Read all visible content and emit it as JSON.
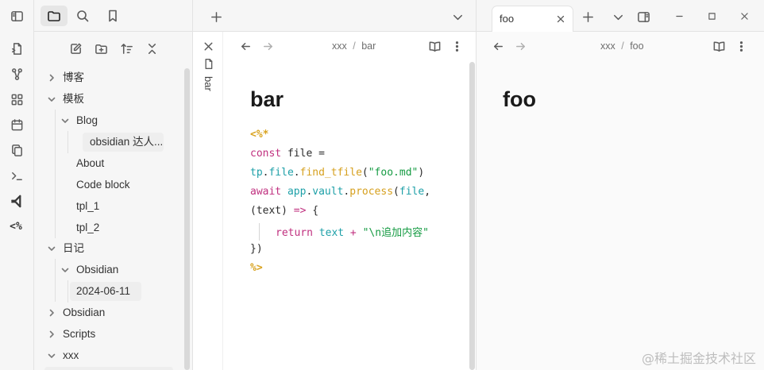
{
  "sidebar": {
    "tree": [
      {
        "label": "博客"
      },
      {
        "label": "模板"
      },
      {
        "label": "Blog"
      },
      {
        "label": "obsidian 达人..."
      },
      {
        "label": "About"
      },
      {
        "label": "Code block"
      },
      {
        "label": "tpl_1"
      },
      {
        "label": "tpl_2"
      },
      {
        "label": "日记"
      },
      {
        "label": "Obsidian"
      },
      {
        "label": "2024-06-11"
      },
      {
        "label": "Obsidian"
      },
      {
        "label": "Scripts"
      },
      {
        "label": "xxx"
      }
    ]
  },
  "pane_left": {
    "breadcrumb": {
      "folder": "xxx",
      "separator": "/",
      "file": "bar"
    },
    "side_tab_label": "bar",
    "title": "bar",
    "code": {
      "open_delim": "<%*",
      "line1_kw": "const",
      "line1_rest": " file =",
      "line2_obj": "tp",
      "line2_dot1": ".",
      "line2_prop": "file",
      "line2_dot2": ".",
      "line2_fn": "find_tfile",
      "line2_open": "(",
      "line2_str": "\"foo.md\"",
      "line2_close": ")",
      "line3_kw": "await",
      "line3_sp": " ",
      "line3_obj": "app",
      "line3_dot1": ".",
      "line3_prop": "vault",
      "line3_dot2": ".",
      "line3_fn": "process",
      "line3_open": "(",
      "line3_arg": "file",
      "line3_comma": ",",
      "line4_params": "(text)",
      "line4_sp": " ",
      "line4_arrow": "=>",
      "line4_brace": " {",
      "line5_kw": "return",
      "line5_sp": " ",
      "line5_var": "text",
      "line5_op": " + ",
      "line5_str": "\"\\n追加内容\"",
      "line6": "})",
      "close_delim": "%>"
    }
  },
  "pane_right": {
    "tab_label": "foo",
    "breadcrumb": {
      "folder": "xxx",
      "separator": "/",
      "file": "foo"
    },
    "title": "foo"
  },
  "watermark": "@稀土掘金技术社区"
}
